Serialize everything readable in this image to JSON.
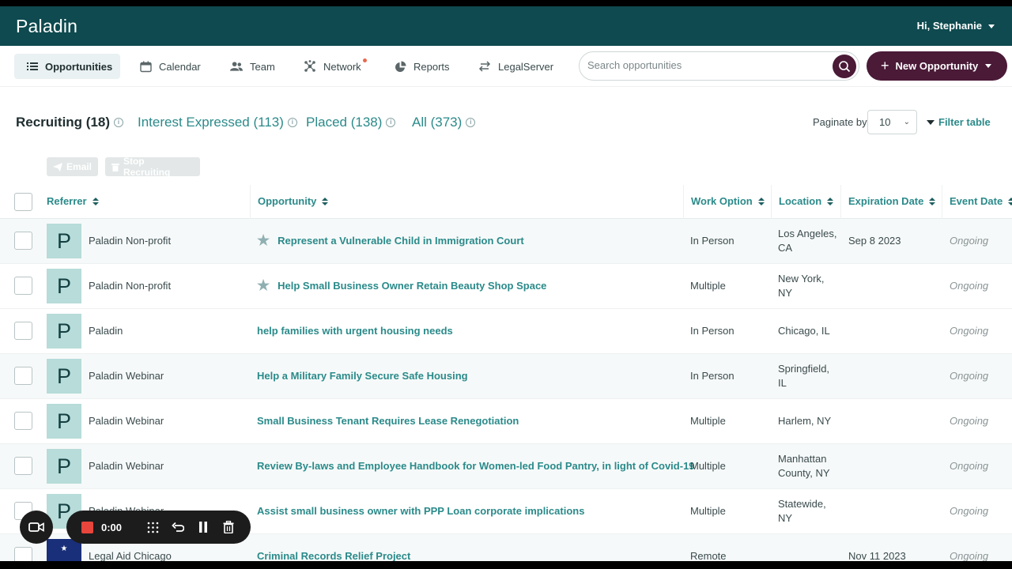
{
  "app": {
    "brand": "Paladin",
    "greeting": "Hi, Stephanie"
  },
  "nav": {
    "items": [
      {
        "label": "Opportunities",
        "icon": "list-icon"
      },
      {
        "label": "Calendar",
        "icon": "calendar-icon"
      },
      {
        "label": "Team",
        "icon": "team-icon"
      },
      {
        "label": "Network",
        "icon": "network-icon"
      },
      {
        "label": "Reports",
        "icon": "pie-chart-icon"
      },
      {
        "label": "LegalServer",
        "icon": "swap-icon"
      }
    ],
    "search_placeholder": "Search opportunities",
    "new_button": "New Opportunity"
  },
  "tabs": [
    {
      "label": "Recruiting (18)"
    },
    {
      "label": "Interest Expressed (113)"
    },
    {
      "label": "Placed (138)"
    },
    {
      "label": "All (373)"
    }
  ],
  "paginate": {
    "label": "Paginate by",
    "value": "10"
  },
  "filter_label": "Filter table",
  "actions": {
    "email": "Email",
    "stop": "Stop Recruiting"
  },
  "columns": {
    "referrer": "Referrer",
    "opportunity": "Opportunity",
    "work_option": "Work Option",
    "location": "Location",
    "expiration": "Expiration Date",
    "event": "Event Date"
  },
  "rows": [
    {
      "avatar": "P",
      "referrer": "Paladin Non-profit",
      "opportunity": "Represent a Vulnerable Child in Immigration Court",
      "starred": true,
      "work_option": "In Person",
      "location_1": "Los Angeles,",
      "location_2": "CA",
      "expiration": "Sep 8 2023",
      "event": "Ongoing"
    },
    {
      "avatar": "P",
      "referrer": "Paladin Non-profit",
      "opportunity": "Help Small Business Owner Retain Beauty Shop Space",
      "starred": true,
      "work_option": "Multiple",
      "location_1": "New York,",
      "location_2": "NY",
      "expiration": "",
      "event": "Ongoing"
    },
    {
      "avatar": "P",
      "referrer": "Paladin",
      "opportunity": "help families with urgent housing needs",
      "starred": false,
      "work_option": "In Person",
      "location_1": "Chicago, IL",
      "location_2": "",
      "expiration": "",
      "event": "Ongoing"
    },
    {
      "avatar": "P",
      "referrer": "Paladin Webinar",
      "opportunity": "Help a Military Family Secure Safe Housing",
      "starred": false,
      "work_option": "In Person",
      "location_1": "Springfield,",
      "location_2": "IL",
      "expiration": "",
      "event": "Ongoing"
    },
    {
      "avatar": "P",
      "referrer": "Paladin Webinar",
      "opportunity": "Small Business Tenant Requires Lease Renegotiation",
      "starred": false,
      "work_option": "Multiple",
      "location_1": "Harlem, NY",
      "location_2": "",
      "expiration": "",
      "event": "Ongoing"
    },
    {
      "avatar": "P",
      "referrer": "Paladin Webinar",
      "opportunity": "Review By-laws and Employee Handbook for Women-led Food Pantry, in light of Covid-19",
      "starred": false,
      "work_option": "Multiple",
      "location_1": "Manhattan",
      "location_2": "County, NY",
      "expiration": "",
      "event": "Ongoing"
    },
    {
      "avatar": "P",
      "referrer": "Paladin Webinar",
      "opportunity": "Assist small business owner with PPP Loan corporate implications",
      "starred": false,
      "work_option": "Multiple",
      "location_1": "Statewide,",
      "location_2": "NY",
      "expiration": "",
      "event": "Ongoing"
    },
    {
      "avatar": "",
      "referrer": "Legal Aid Chicago",
      "opportunity": "Criminal Records Relief Project",
      "starred": false,
      "work_option": "Remote",
      "location_1": "",
      "location_2": "",
      "expiration": "Nov 11 2023",
      "event": "Ongoing"
    }
  ],
  "recorder": {
    "time": "0:00"
  },
  "colors": {
    "topbar": "#0e4a4f",
    "accent": "#2b8a8a",
    "primary_button": "#4a1a37",
    "record": "#e8453c"
  }
}
